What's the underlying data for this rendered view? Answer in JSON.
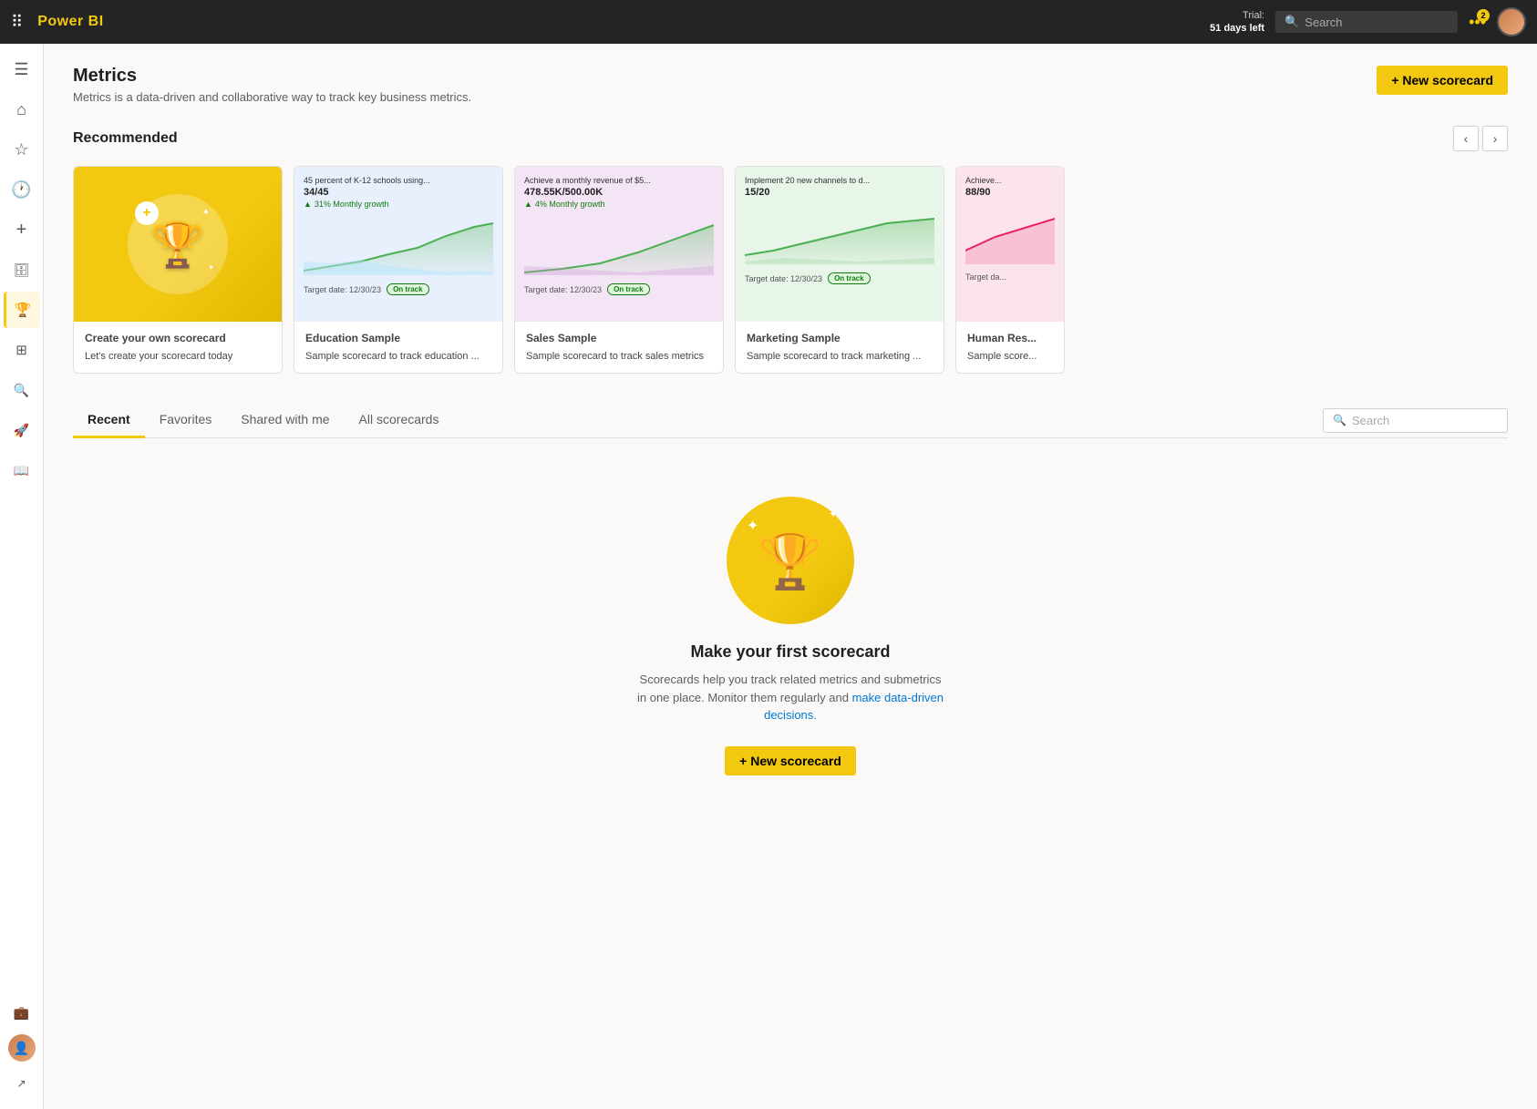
{
  "topbar": {
    "logo": "Power BI",
    "trial_label": "Trial:",
    "trial_days": "51 days left",
    "search_placeholder": "Search",
    "notif_count": "2"
  },
  "sidebar": {
    "items": [
      {
        "id": "menu",
        "icon": "☰",
        "label": "Menu"
      },
      {
        "id": "home",
        "icon": "⌂",
        "label": "Home"
      },
      {
        "id": "favorites",
        "icon": "☆",
        "label": "Favorites"
      },
      {
        "id": "recent",
        "icon": "🕐",
        "label": "Recent"
      },
      {
        "id": "create",
        "icon": "+",
        "label": "Create"
      },
      {
        "id": "dataHub",
        "icon": "🗄",
        "label": "Data Hub"
      },
      {
        "id": "metrics",
        "icon": "🏆",
        "label": "Metrics",
        "active": true
      },
      {
        "id": "apps",
        "icon": "⊞",
        "label": "Apps"
      },
      {
        "id": "learn",
        "icon": "🔍",
        "label": "Learn"
      },
      {
        "id": "scorecard",
        "icon": "🚀",
        "label": "Scorecard"
      },
      {
        "id": "browse",
        "icon": "📖",
        "label": "Browse"
      }
    ],
    "bottom": [
      {
        "id": "workspaces",
        "icon": "💼",
        "label": "Workspaces"
      },
      {
        "id": "profile",
        "icon": "👤",
        "label": "Profile"
      },
      {
        "id": "expand",
        "icon": "↗",
        "label": "Expand"
      }
    ]
  },
  "page": {
    "title": "Metrics",
    "subtitle": "Metrics is a data-driven and collaborative way to track key business metrics.",
    "new_scorecard_label": "+ New scorecard",
    "recommended_label": "Recommended"
  },
  "cards": [
    {
      "id": "create",
      "title": "Create your own scorecard",
      "footer": "Let's create your scorecard today",
      "type": "create"
    },
    {
      "id": "education",
      "title": "Education Sample",
      "footer": "Sample scorecard to track education ...",
      "type": "sample",
      "bg": "blue",
      "metric_title": "45 percent of K-12 schools using...",
      "metric_value": "34/45",
      "growth_pct": "31% Monthly growth",
      "target_date": "Target date: 12/30/23",
      "status": "On track"
    },
    {
      "id": "sales",
      "title": "Sales Sample",
      "footer": "Sample scorecard to track sales metrics",
      "type": "sample",
      "bg": "purple",
      "metric_title": "Achieve a monthly revenue of $5...",
      "metric_value": "478.55K/500.00K",
      "growth_pct": "4% Monthly growth",
      "target_date": "Target date: 12/30/23",
      "status": "On track"
    },
    {
      "id": "marketing",
      "title": "Marketing Sample",
      "footer": "Sample scorecard to track marketing ...",
      "type": "sample",
      "bg": "green",
      "metric_title": "Implement 20 new channels to d...",
      "metric_value": "15/20",
      "growth_pct": "",
      "target_date": "Target date: 12/30/23",
      "status": "On track"
    },
    {
      "id": "humanres",
      "title": "Human Res...",
      "footer": "Sample score...",
      "type": "sample",
      "bg": "pink",
      "metric_title": "Achieve...",
      "metric_value": "88/90",
      "growth_pct": "",
      "target_date": "Target da...",
      "status": ""
    }
  ],
  "tabs": {
    "items": [
      {
        "id": "recent",
        "label": "Recent",
        "active": true
      },
      {
        "id": "favorites",
        "label": "Favorites"
      },
      {
        "id": "shared",
        "label": "Shared with me"
      },
      {
        "id": "all",
        "label": "All scorecards"
      }
    ],
    "search_placeholder": "Search"
  },
  "empty_state": {
    "title": "Make your first scorecard",
    "subtitle_plain": "Scorecards help you track related metrics and submetrics in one place. Monitor them regularly and ",
    "subtitle_link": "make data-driven decisions.",
    "cta_label": "+ New scorecard"
  }
}
